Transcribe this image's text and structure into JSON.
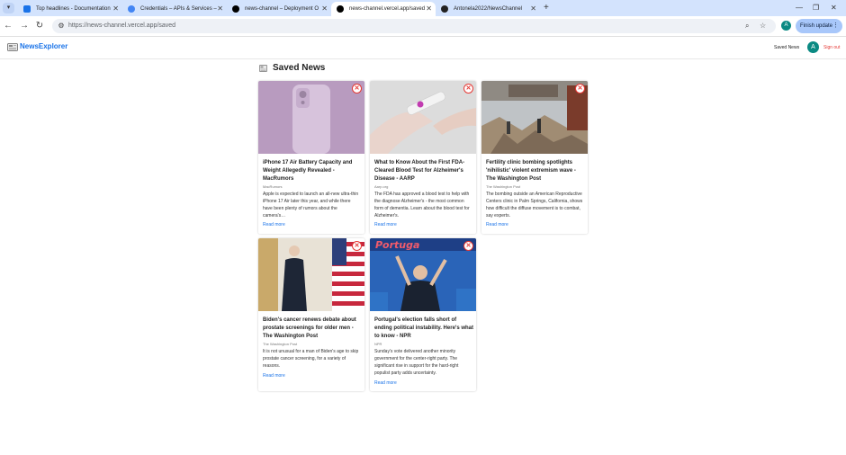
{
  "browser": {
    "tabs": [
      {
        "label": "Top headlines - Documentation",
        "favicon_color": "#1a73e8"
      },
      {
        "label": "Credentials – APIs & Services –",
        "favicon_color": "#4285f4"
      },
      {
        "label": "news-channel – Deployment O",
        "favicon_color": "#000000"
      },
      {
        "label": "news-channel.vercel.app/saved",
        "favicon_color": "#000000"
      },
      {
        "label": "Antonela2022/NewsChannel",
        "favicon_color": "#222222"
      }
    ],
    "active_tab_index": 3,
    "new_tab_glyph": "+",
    "url": "https://news-channel.vercel.app/saved",
    "profile_initial": "A",
    "update_button_label": "Finish update"
  },
  "site": {
    "logo_text": "NewsExplorer",
    "nav_saved": "Saved News",
    "user_initial": "A",
    "sign_out": "Sign out"
  },
  "page": {
    "title": "Saved News",
    "read_more": "Read more",
    "articles": [
      {
        "title": "iPhone 17 Air Battery Capacity and Weight Allegedly Revealed - MacRumors",
        "source": "MacRumors",
        "description": "Apple is expected to launch an all-new ultra-thin iPhone 17 Air later this year, and while there have been plenty of rumors about the camera's…",
        "image_icon": "phone-image"
      },
      {
        "title": "What to Know About the First FDA-Cleared Blood Test for Alzheimer's Disease - AARP",
        "source": "Aarp.org",
        "description": "The FDA has approved a blood test to help with the diagnose Alzheimer's - the most common form of dementia. Learn about the blood test for Alzheimer's.",
        "image_icon": "blood-test-image"
      },
      {
        "title": "Fertility clinic bombing spotlights 'nihilistic' violent extremism wave - The Washington Post",
        "source": "The Washington Post",
        "description": "The bombing outside an American Reproductive Centers clinic in Palm Springs, California, shows how difficult the diffuse movement is to combat, say experts.",
        "image_icon": "bombing-site-image"
      },
      {
        "title": "Biden's cancer renews debate about prostate screenings for older men - The Washington Post",
        "source": "The Washington Post",
        "description": "It is not unusual for a man of Biden's age to skip prostate cancer screening, for a variety of reasons.",
        "image_icon": "biden-image"
      },
      {
        "title": "Portugal's election falls short of ending political instability. Here's what to know - NPR",
        "source": "NPR",
        "description": "Sunday's vote delivered another minority government for the center-right party. The significant rise in support for the hard-right populist party adds uncertainty.",
        "image_icon": "portugal-election-image",
        "image_banner": "Portuga"
      }
    ]
  }
}
